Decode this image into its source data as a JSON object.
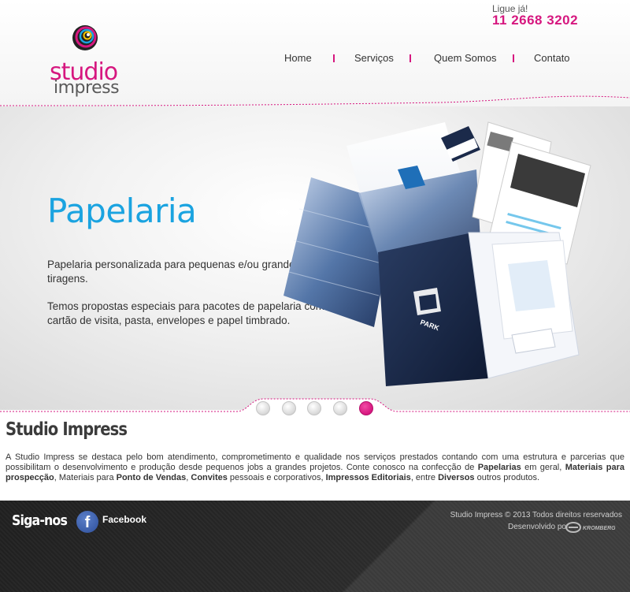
{
  "brand": {
    "logo_word1": "studio",
    "logo_word2": "impress",
    "accent_color": "#d6177f",
    "title_color": "#1aa3e0"
  },
  "header": {
    "phone_label": "Ligue já!",
    "phone_number": "11 2668 3202"
  },
  "nav": {
    "items": [
      {
        "label": "Home"
      },
      {
        "label": "Serviços"
      },
      {
        "label": "Quem Somos"
      },
      {
        "label": "Contato"
      }
    ]
  },
  "banner": {
    "title": "Papelaria",
    "paragraph1": "Papelaria personalizada para pequenas e/ou grandes tiragens.",
    "paragraph2": "Temos propostas especiais para pacotes de papelaria com cartão de visita, pasta, envelopes e papel timbrado.",
    "art_brand": "PARK"
  },
  "slider": {
    "slide_count": 5,
    "active_index": 4
  },
  "about": {
    "title": "Studio Impress",
    "text_1": "A Studio Impress se destaca pelo bom atendimento, comprometimento e qualidade nos serviços prestados contando com uma estrutura e parcerias que possibilitam o desenvolvimento e produção desde pequenos jobs a grandes projetos. Conte conosco na confecção de ",
    "bold_1": "Papelarias",
    "text_2": " em geral, ",
    "bold_2": "Materiais para prospecção",
    "text_3": ", Materiais para ",
    "bold_3": "Ponto de Vendas",
    "text_4": ", ",
    "bold_4": "Convites",
    "text_5": " pessoais e corporativos, ",
    "bold_5": "Impressos Editoriais",
    "text_6": ", entre ",
    "bold_6": "Diversos",
    "text_7": " outros produtos."
  },
  "footer": {
    "follow_label": "Siga-nos",
    "facebook_label": "Facebook",
    "facebook_glyph": "f",
    "copyright": "Studio Impress © 2013 Todos direitos reservados",
    "developed_by": "Desenvolvido por",
    "developer_name": "KROMBERG"
  }
}
